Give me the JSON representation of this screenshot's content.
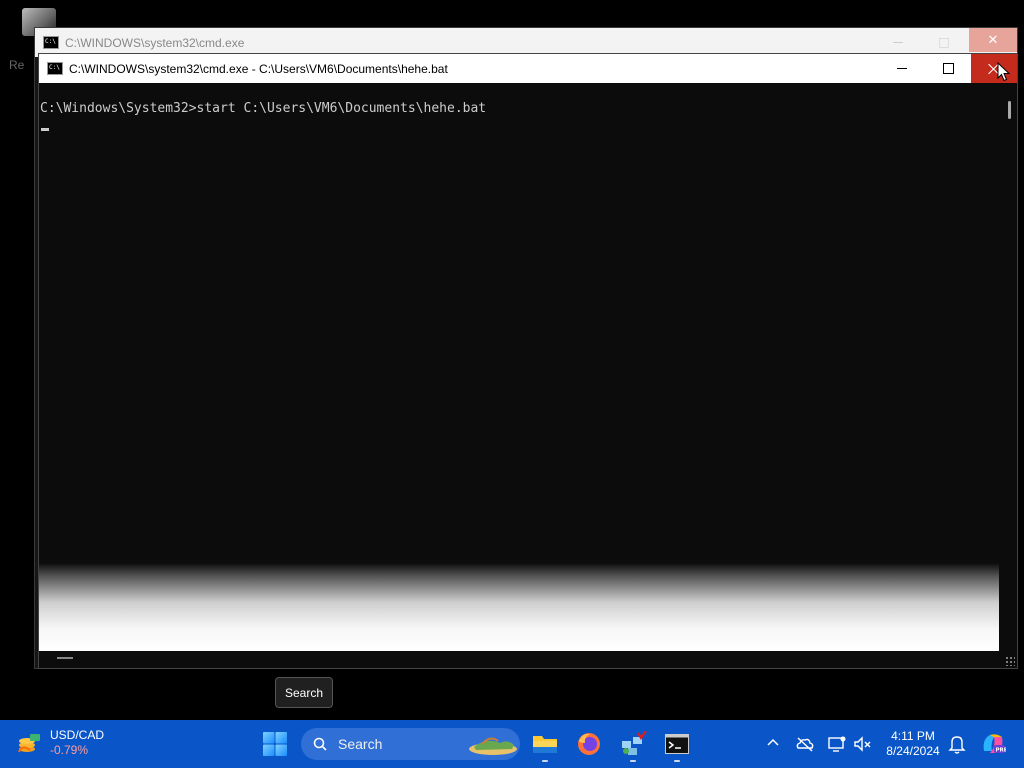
{
  "back_window": {
    "title": "C:\\WINDOWS\\system32\\cmd.exe",
    "close_glyph": "✕"
  },
  "front_window": {
    "title": "C:\\WINDOWS\\system32\\cmd.exe - C:\\Users\\VM6\\Documents\\hehe.bat",
    "console_line": "C:\\Windows\\System32>start C:\\Users\\VM6\\Documents\\hehe.bat"
  },
  "desktop": {
    "fragment_label": "Re"
  },
  "tooltip": {
    "text": "Search"
  },
  "taskbar": {
    "widget": {
      "title": "USD/CAD",
      "change": "-0.79%"
    },
    "search": {
      "placeholder": "Search"
    },
    "clock": {
      "time": "4:11 PM",
      "date": "8/24/2024"
    }
  },
  "icons": [
    "cmd-icon",
    "minimize-icon",
    "maximize-icon",
    "close-icon",
    "mouse-cursor-icon",
    "windows-start-icon",
    "search-icon",
    "file-explorer-icon",
    "firefox-icon",
    "network-tool-icon",
    "terminal-icon",
    "chevron-up-icon",
    "onedrive-off-icon",
    "display-icon",
    "volume-muted-icon",
    "notification-bell-icon",
    "copilot-icon"
  ],
  "colors": {
    "taskbar": "#0a56c8",
    "close_red": "#c42b1c",
    "console_bg": "#0c0c0c",
    "console_text": "#cccccc",
    "negative_change": "#ff9c9c"
  }
}
